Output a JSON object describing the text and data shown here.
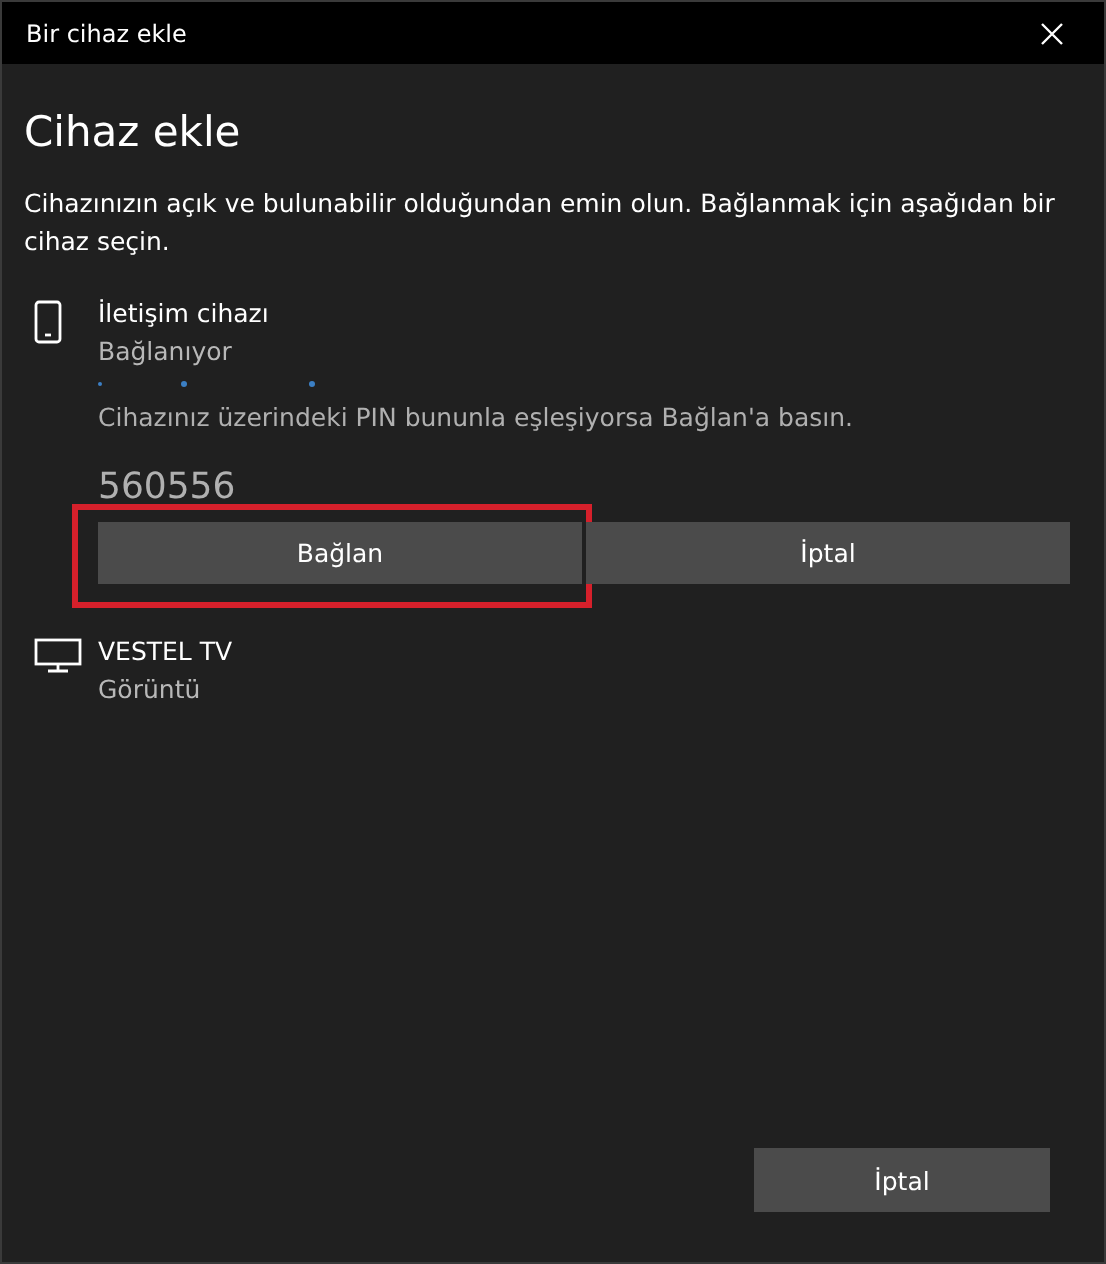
{
  "window": {
    "title": "Bir cihaz ekle"
  },
  "heading": "Cihaz ekle",
  "description": "Cihazınızın açık ve bulunabilir olduğundan emin olun. Bağlanmak için aşağıdan bir cihaz seçin.",
  "devices": [
    {
      "kind": "phone",
      "name": "İletişim cihazı",
      "status": "Bağlanıyor",
      "connecting": true,
      "pairing": {
        "message": "Cihazınız üzerindeki PIN bununla eşleşiyorsa Bağlan'a basın.",
        "pin": "560556",
        "buttons": [
          {
            "label": "Bağlan",
            "highlighted": true
          },
          {
            "label": "İptal",
            "highlighted": false
          }
        ]
      }
    },
    {
      "kind": "monitor",
      "name": "VESTEL TV",
      "status": "Görüntü",
      "connecting": false
    }
  ],
  "footer_button": "İptal"
}
